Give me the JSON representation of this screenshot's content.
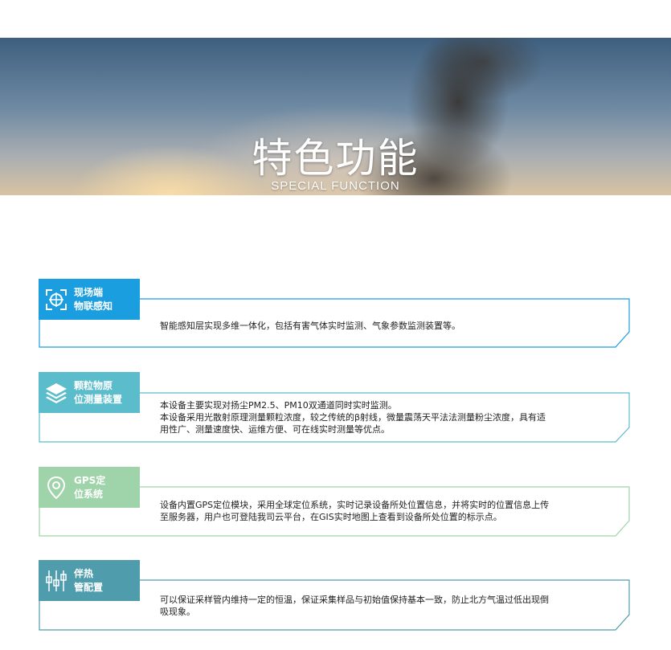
{
  "banner": {
    "title": "特色功能",
    "subtitle": "SPECIAL FUNCTION"
  },
  "features": [
    {
      "icon": "sensor-target-icon",
      "color": "#1a9ee0",
      "label_line1": "现场端",
      "label_line2": "物联感知",
      "desc_lines": [
        "智能感知层实现多维一体化，包括有害气体实时监测、气象参数监测装置等。"
      ]
    },
    {
      "icon": "layers-icon",
      "color": "#5bbdcb",
      "label_line1": "颗粒物原",
      "label_line2": "位测量装置",
      "desc_lines": [
        "本设备主要实现对扬尘PM2.5、PM10双通道同时实时监测。",
        "本设备采用光散射原理测量颗粒浓度，较之传统的β射线，微量震荡天平法法测量粉尘浓度，具有适",
        "用性广、测量速度快、运维方便、可在线实时测量等优点。"
      ]
    },
    {
      "icon": "location-pin-icon",
      "color": "#9fd3a9",
      "label_line1": "GPS定",
      "label_line2": "位系统",
      "desc_lines": [
        "设备内置GPS定位模块，采用全球定位系统，实时记录设备所处位置信息，并将实时的位置信息上传",
        "至服务器，用户也可登陆我司云平台，在GIS实时地图上查看到设备所处位置的标示点。"
      ]
    },
    {
      "icon": "heat-pipe-icon",
      "color": "#4f9dac",
      "label_line1": "伴热",
      "label_line2": "管配置",
      "desc_lines": [
        "可以保证采样管内维持一定的恒温，保证采集样品与初始值保持基本一致，防止北方气温过低出现倒",
        "吸现象。"
      ]
    }
  ]
}
